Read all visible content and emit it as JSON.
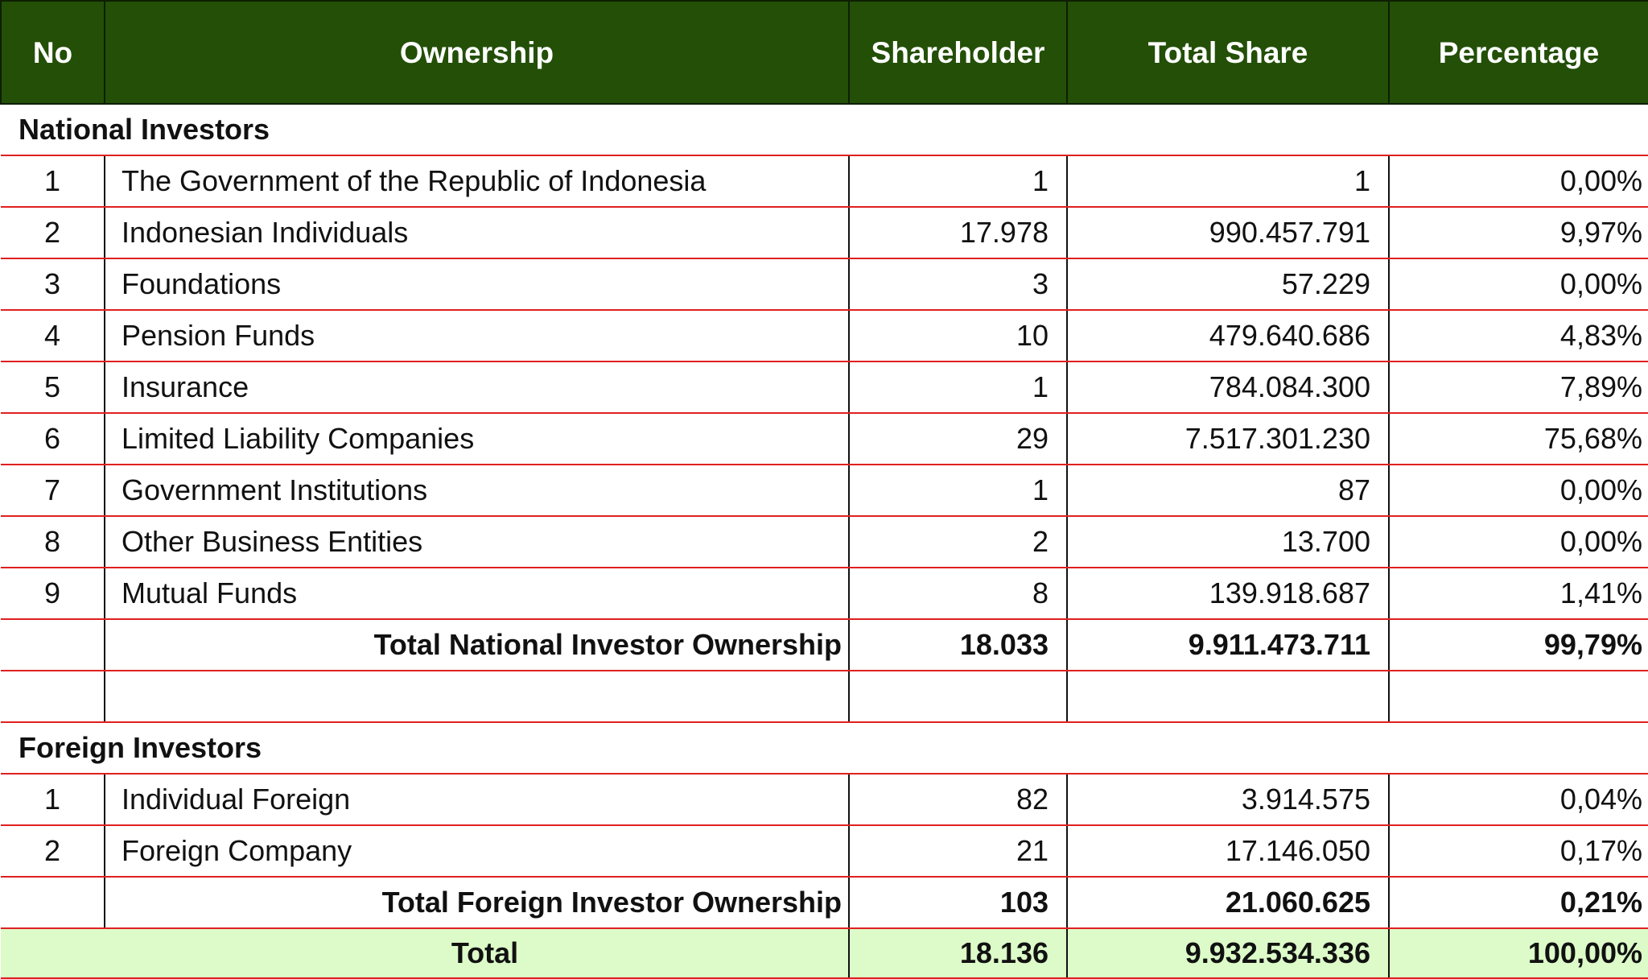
{
  "headers": {
    "no": "No",
    "ownership": "Ownership",
    "shareholder": "Shareholder",
    "total_share": "Total Share",
    "percentage": "Percentage"
  },
  "national": {
    "title": "National Investors",
    "rows": [
      {
        "no": "1",
        "ownership": "The Government of the Republic of Indonesia",
        "shareholder": "1",
        "total_share": "1",
        "percentage": "0,00%"
      },
      {
        "no": "2",
        "ownership": "Indonesian Individuals",
        "shareholder": "17.978",
        "total_share": "990.457.791",
        "percentage": "9,97%"
      },
      {
        "no": "3",
        "ownership": "Foundations",
        "shareholder": "3",
        "total_share": "57.229",
        "percentage": "0,00%"
      },
      {
        "no": "4",
        "ownership": "Pension Funds",
        "shareholder": "10",
        "total_share": "479.640.686",
        "percentage": "4,83%"
      },
      {
        "no": "5",
        "ownership": "Insurance",
        "shareholder": "1",
        "total_share": "784.084.300",
        "percentage": "7,89%"
      },
      {
        "no": "6",
        "ownership": "Limited Liability Companies",
        "shareholder": "29",
        "total_share": "7.517.301.230",
        "percentage": "75,68%"
      },
      {
        "no": "7",
        "ownership": "Government Institutions",
        "shareholder": "1",
        "total_share": "87",
        "percentage": "0,00%"
      },
      {
        "no": "8",
        "ownership": "Other Business Entities",
        "shareholder": "2",
        "total_share": "13.700",
        "percentage": "0,00%"
      },
      {
        "no": "9",
        "ownership": "Mutual Funds",
        "shareholder": "8",
        "total_share": "139.918.687",
        "percentage": "1,41%"
      }
    ],
    "subtotal": {
      "label": "Total National Investor Ownership",
      "shareholder": "18.033",
      "total_share": "9.911.473.711",
      "percentage": "99,79%"
    }
  },
  "foreign": {
    "title": "Foreign Investors",
    "rows": [
      {
        "no": "1",
        "ownership": "Individual Foreign",
        "shareholder": "82",
        "total_share": "3.914.575",
        "percentage": "0,04%"
      },
      {
        "no": "2",
        "ownership": "Foreign Company",
        "shareholder": "21",
        "total_share": "17.146.050",
        "percentage": "0,17%"
      }
    ],
    "subtotal": {
      "label": "Total Foreign Investor Ownership",
      "shareholder": "103",
      "total_share": "21.060.625",
      "percentage": "0,21%"
    }
  },
  "total": {
    "label": "Total",
    "shareholder": "18.136",
    "total_share": "9.932.534.336",
    "percentage": "100,00%"
  },
  "colors": {
    "header_bg": "#234f07",
    "header_text": "#ffffff",
    "row_rule": "#e02020",
    "total_bg": "#dcfbc8"
  }
}
